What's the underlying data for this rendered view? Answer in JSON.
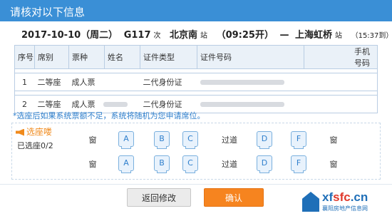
{
  "dialog": {
    "title": "请核对以下信息"
  },
  "trip": {
    "date": "2017-10-10（周二）",
    "train_no": "G117",
    "train_suffix": "次",
    "from_station": "北京南",
    "from_suffix": "站",
    "depart": "（09:25开）",
    "sep": "—",
    "to_station": "上海虹桥",
    "to_suffix": "站",
    "arrive": "（15:37到）"
  },
  "table": {
    "headers": [
      "序号",
      "席别",
      "票种",
      "姓名",
      "证件类型",
      "证件号码",
      "手机号码"
    ],
    "rows": [
      {
        "no": "1",
        "seat_class": "二等座",
        "ticket_type": "成人票",
        "name": "",
        "id_type": "二代身份证",
        "id_no": "",
        "phone": ""
      },
      {
        "no": "2",
        "seat_class": "二等座",
        "ticket_type": "成人票",
        "name": "",
        "id_type": "二代身份证",
        "id_no": "",
        "phone": ""
      }
    ]
  },
  "notice": "*选座后如果系统票额不足，系统将随机为您申请席位。",
  "seat_select": {
    "label": "选座喽",
    "count": "已选座0/2",
    "window": "窗",
    "aisle": "过道",
    "left_seats": [
      "A",
      "B",
      "C"
    ],
    "right_seats": [
      "D",
      "F"
    ]
  },
  "buttons": {
    "back": "返回修改",
    "confirm": "确认"
  },
  "watermark": {
    "brand_prefix": "xf",
    "brand_highlight": "sfc",
    "brand_suffix": ".cn",
    "tagline": "襄阳房地产信息网"
  }
}
